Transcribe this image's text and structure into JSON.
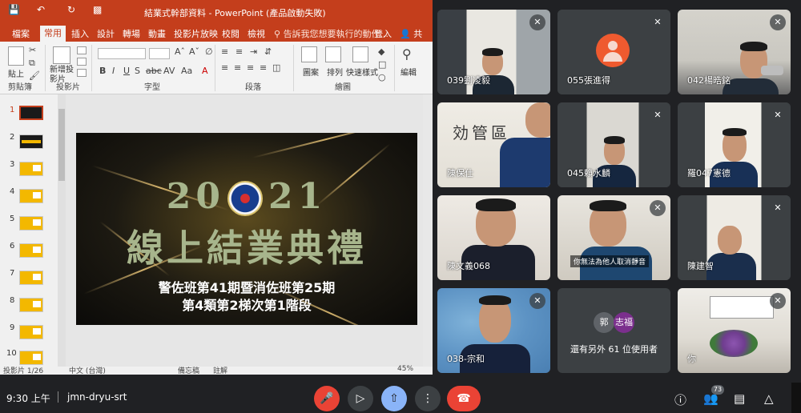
{
  "ppt": {
    "title": "結業式幹部資料 - PowerPoint (產品啟動失敗)",
    "quick_access": [
      "save",
      "undo",
      "redo",
      "present"
    ],
    "tabs": [
      "檔案",
      "常用",
      "插入",
      "設計",
      "轉場",
      "動畫",
      "投影片放映",
      "校閱",
      "檢視"
    ],
    "active_tab": "常用",
    "tell_me": "告訴我您想要執行的動作...",
    "login": "登入",
    "share": "共用",
    "groups": {
      "clipboard": "剪貼簿",
      "slides": "投影片",
      "font": "字型",
      "paragraph": "段落",
      "drawing": "繪圖",
      "editing": "編輯"
    },
    "buttons": {
      "paste": "貼上",
      "new_slide": "新增投影片",
      "shapes": "圖案",
      "arrange": "排列",
      "quick_styles": "快速樣式",
      "edit": "編輯"
    },
    "format_buttons": [
      "B",
      "I",
      "U",
      "S",
      "abc",
      "AV",
      "Aa",
      "A"
    ],
    "thumb_numbers": [
      "1",
      "2",
      "3",
      "4",
      "5",
      "6",
      "7",
      "8",
      "9",
      "10"
    ],
    "slide": {
      "year_left": "20",
      "year_right": "21",
      "title": "線上結業典禮",
      "line1": "警佐班第41期暨消佐班第25期",
      "line2": "第4類第2梯次第1階段"
    },
    "status": {
      "slide_count": "投影片 1/26",
      "language": "中文 (台灣)",
      "notes": "備忘稿",
      "comments": "註解",
      "zoom": "45%"
    }
  },
  "participants": [
    {
      "name": "039劉凌毅",
      "muted": true
    },
    {
      "name": "055張進得",
      "muted": true
    },
    {
      "name": "042楊晧銘",
      "muted": true
    },
    {
      "name": "陳保仕",
      "muted": false
    },
    {
      "name": "045賴水麟",
      "muted": true
    },
    {
      "name": "羅047憲德",
      "muted": true
    },
    {
      "name": "陳文義068",
      "muted": false
    },
    {
      "name": "你無法為他人取消靜音",
      "muted": true
    },
    {
      "name": "陳建智",
      "muted": true
    },
    {
      "name": "038-宗和",
      "muted": true
    },
    {
      "name": "others",
      "muted": false
    },
    {
      "name": "你",
      "muted": true
    }
  ],
  "others_tile": {
    "avatar1": "郭",
    "avatar2": "志福",
    "text": "還有另外 61 位使用者",
    "avatar1_color": "#5f6368",
    "avatar2_color": "#7b2f8d"
  },
  "meet": {
    "time": "9:30 上午",
    "meeting_code": "jmn-dryu-srt",
    "people_count": "73",
    "controls": [
      "mic-off",
      "camera",
      "present",
      "more",
      "hangup"
    ],
    "right_controls": [
      "info",
      "people",
      "chat",
      "activities"
    ]
  },
  "colors": {
    "ppt_accent": "#c43e1c",
    "meet_bg": "#202124",
    "hangup": "#ea4335",
    "present_active": "#8ab4f8"
  }
}
